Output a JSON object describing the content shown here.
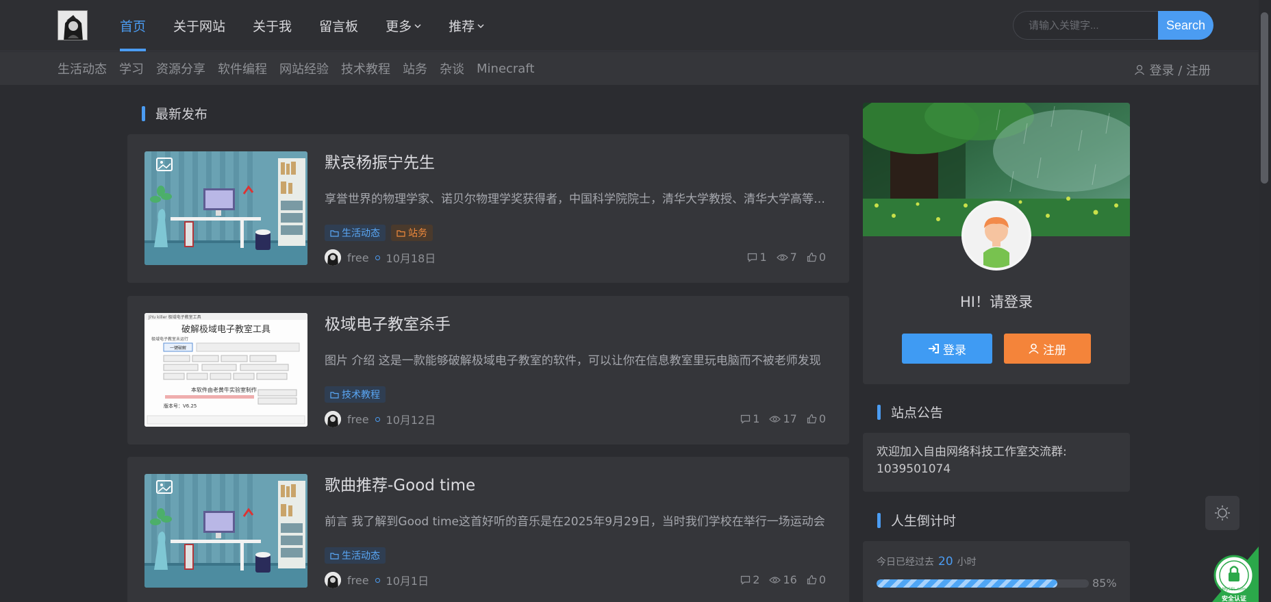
{
  "header": {
    "nav": [
      "首页",
      "关于网站",
      "关于我",
      "留言板",
      "更多",
      "推荐"
    ],
    "search": {
      "placeholder": "请输入关键字...",
      "button": "Search"
    }
  },
  "subnav": {
    "items": [
      "生活动态",
      "学习",
      "资源分享",
      "软件编程",
      "网站经验",
      "技术教程",
      "站务",
      "杂谈",
      "Minecraft"
    ],
    "login": "登录 / 注册"
  },
  "main": {
    "section_title": "最新发布",
    "posts": [
      {
        "title": "默哀杨振宁先生",
        "excerpt": "享誉世界的物理学家、诺贝尔物理学奖获得者，中国科学院院士，清华大学教授、清华大学高等研究院名誉院长杨振宁先生",
        "tags": [
          {
            "label": "生活动态",
            "color": "blue"
          },
          {
            "label": "站务",
            "color": "orange"
          }
        ],
        "author": "free",
        "date": "10月18日",
        "comments": "1",
        "views": "7",
        "likes": "0",
        "thumb": "room"
      },
      {
        "title": "极域电子教室杀手",
        "excerpt": "图片 介绍 这是一款能够破解极域电子教室的软件，可以让你在信息教室里玩电脑而不被老师发现",
        "tags": [
          {
            "label": "技术教程",
            "color": "blue"
          }
        ],
        "author": "free",
        "date": "10月12日",
        "comments": "1",
        "views": "17",
        "likes": "0",
        "thumb": "software",
        "thumb_texts": {
          "window_title": "JiYu killer 极域电子教室工具",
          "heading": "破解极域电子教室工具",
          "status": "极域电子教室未运行",
          "btn1": "一键破解",
          "credit": "本软件由老黄牛实验室制作",
          "version": "版本号：V6.25"
        }
      },
      {
        "title": "歌曲推荐-Good time",
        "excerpt": "前言 我了解到Good time这首好听的音乐是在2025年9月29日，当时我们学校在举行一场运动会",
        "tags": [
          {
            "label": "生活动态",
            "color": "blue"
          }
        ],
        "author": "free",
        "date": "10月1日",
        "comments": "2",
        "views": "16",
        "likes": "0",
        "thumb": "room"
      }
    ]
  },
  "sidebar": {
    "greeting": "HI！请登录",
    "login_btn": "登录",
    "register_btn": "注册",
    "notice_title": "站点公告",
    "notice_text": "欢迎加入自由网络科技工作室交流群: 1039501074",
    "countdown_title": "人生倒计时",
    "countdown_label_pre": "今日已经过去",
    "countdown_value": "20",
    "countdown_label_post": "小时",
    "countdown_percent": "85%",
    "countdown_fraction": 0.85
  },
  "badge": {
    "line1": "安全认证",
    "brand": "MySSL.com"
  },
  "colors": {
    "accent": "#4b9cf2",
    "orange": "#f4843a",
    "bg": "#2b2c30",
    "card": "#35363a"
  }
}
